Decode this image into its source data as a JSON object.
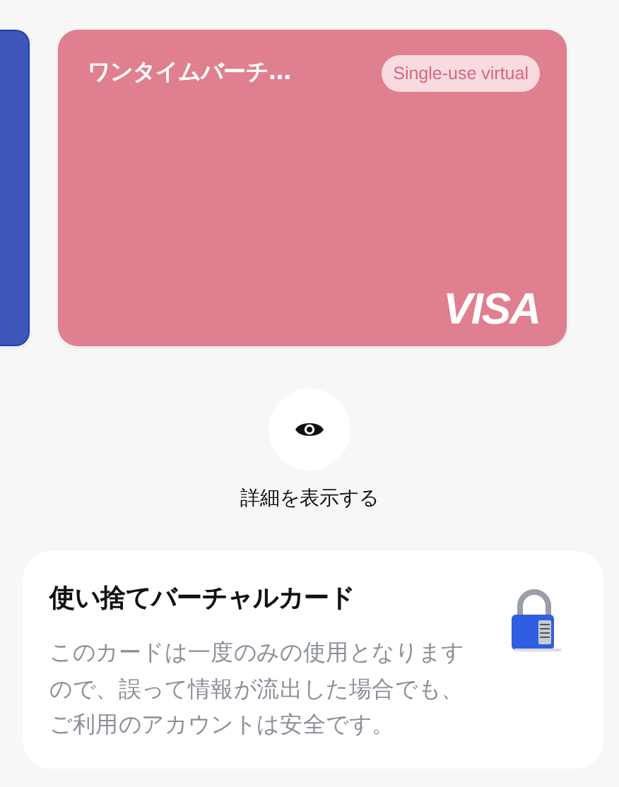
{
  "cards": [
    {
      "color": "#3e56b9"
    },
    {
      "color": "#e07f8f",
      "name": "ワンタイムバーチ…",
      "badge": "Single-use virtual",
      "brand": "VISA"
    }
  ],
  "details_button": {
    "label": "詳細を表示する"
  },
  "info": {
    "title": "使い捨てバーチャルカード",
    "body": "このカードは一度のみの使用となりますので、誤って情報が流出した場合でも、ご利用のアカウントは安全です。"
  }
}
